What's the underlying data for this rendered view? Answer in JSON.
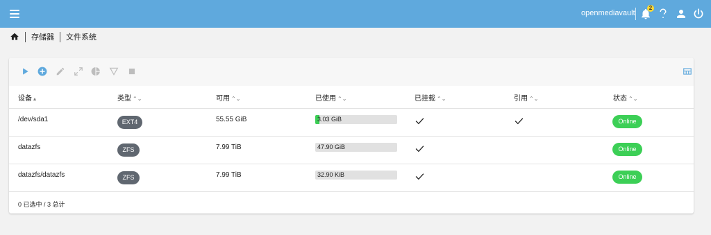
{
  "topbar": {
    "hostname": "openmediavault",
    "notification_count": "2",
    "icons": [
      "menu-icon",
      "bell-icon",
      "help-icon",
      "user-icon",
      "power-icon"
    ],
    "color": "#5fa9dd"
  },
  "breadcrumb": {
    "items": [
      "存储器",
      "文件系统"
    ]
  },
  "toolbar": {
    "icons": [
      "play-icon",
      "add-circle-icon",
      "edit-icon",
      "expand-icon",
      "pie-chart-icon",
      "filter-icon",
      "stop-icon",
      "table-columns-icon"
    ]
  },
  "table": {
    "columns": [
      {
        "label": "设备",
        "sort": "▴"
      },
      {
        "label": "类型",
        "sort": "⌃⌄"
      },
      {
        "label": "可用",
        "sort": "⌃⌄"
      },
      {
        "label": "已使用",
        "sort": "⌃⌄"
      },
      {
        "label": "已挂载",
        "sort": "⌃⌄"
      },
      {
        "label": "引用",
        "sort": "⌃⌄"
      },
      {
        "label": "状态",
        "sort": "⌃⌄"
      }
    ],
    "rows": [
      {
        "device": "/dev/sda1",
        "type": "EXT4",
        "available": "55.55 GiB",
        "used": "3.03 GiB",
        "used_fraction": 0.05,
        "mounted": true,
        "referenced": true,
        "status": "Online"
      },
      {
        "device": "datazfs",
        "type": "ZFS",
        "available": "7.99 TiB",
        "used": "47.90 GiB",
        "used_fraction": 0.0,
        "mounted": true,
        "referenced": false,
        "status": "Online"
      },
      {
        "device": "datazfs/datazfs",
        "type": "ZFS",
        "available": "7.99 TiB",
        "used": "32.90 KiB",
        "used_fraction": 0.0,
        "mounted": true,
        "referenced": false,
        "status": "Online"
      }
    ]
  },
  "footer": {
    "summary": "0 已选中 / 3 总计"
  },
  "colors": {
    "accent": "#5fa9dd",
    "online": "#3ccf56",
    "type_pill": "#606770"
  }
}
